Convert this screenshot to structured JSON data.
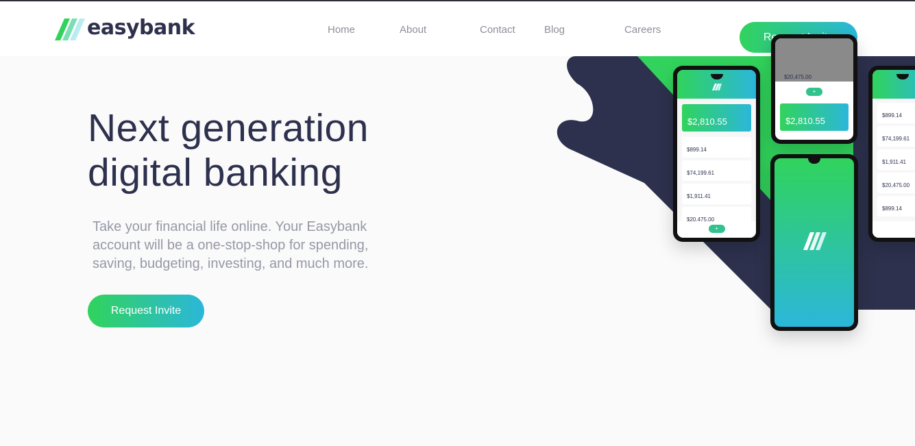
{
  "brand": {
    "name": "easybank"
  },
  "nav": {
    "links": [
      {
        "label": "Home"
      },
      {
        "label": "About"
      },
      {
        "label": "Contact"
      },
      {
        "label": "Blog"
      },
      {
        "label": "Careers"
      }
    ],
    "cta_label": "Request Invite"
  },
  "hero": {
    "title_line1": "Next generation",
    "title_line2": "digital banking",
    "text_line1": "Take your financial life online. Your Easybank",
    "text_line2": "account will be a one-stop-shop for spending,",
    "text_line3": "saving, budgeting, investing, and much more.",
    "cta_label": "Request Invite"
  },
  "mockups": {
    "phone_left": {
      "total": "$2,810.55",
      "accounts": [
        "$899.14",
        "$74,199.61",
        "$1,911.41",
        "$20,475.00"
      ]
    },
    "phone_top": {
      "top_amount": "$20,475.00",
      "total": "$2,810.55"
    },
    "phone_right": {
      "accounts": [
        "$899.14",
        "$74,199.61",
        "$1,911.41",
        "$20,475.00",
        "$899.14"
      ]
    }
  },
  "colors": {
    "dark_blue": "#2d314d",
    "lime_green": "#31d35c",
    "bright_cyan": "#2bb7da",
    "grayish_blue": "#9698a6",
    "background": "#fafafa"
  },
  "icons": [
    "easybank-logo-mark",
    "plus-icon"
  ]
}
